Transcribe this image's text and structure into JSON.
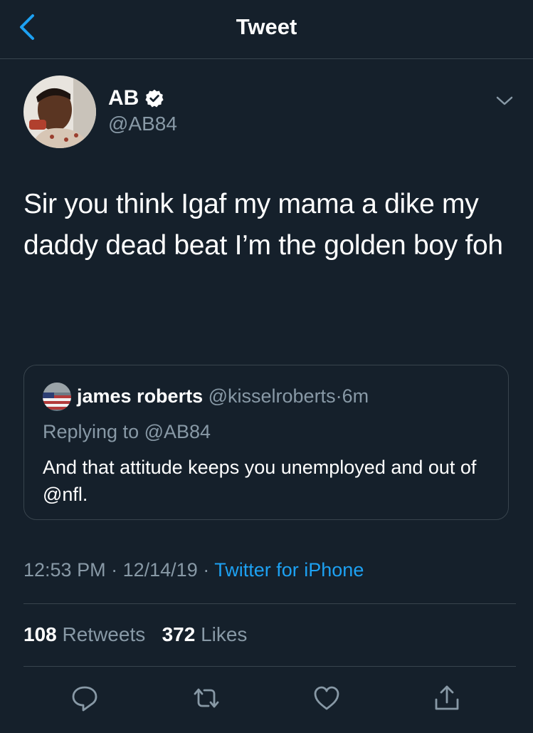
{
  "header": {
    "title": "Tweet",
    "back_icon": "chevron-left-icon"
  },
  "author": {
    "name": "AB",
    "verified": true,
    "handle": "@AB84"
  },
  "tweet": {
    "text": "Sir you think Igaf my mama a dike my daddy dead beat I’m the golden boy foh"
  },
  "quoted": {
    "name": "james roberts",
    "handle": "@kisselroberts",
    "separator": "·",
    "time": "6m",
    "replying_prefix": "Replying to",
    "replying_handle": "@AB84",
    "text": "And that attitude keeps you unemployed and out of @nfl."
  },
  "meta": {
    "time": "12:53 PM",
    "sep1": "·",
    "date": "12/14/19",
    "sep2": "·",
    "source": "Twitter for iPhone"
  },
  "stats": {
    "retweets_count": "108",
    "retweets_label": "Retweets",
    "likes_count": "372",
    "likes_label": "Likes"
  },
  "actions": [
    "reply-icon",
    "retweet-icon",
    "like-icon",
    "share-icon"
  ],
  "colors": {
    "background": "#15202b",
    "accent": "#1da1f2",
    "secondary_text": "#8899a6",
    "border": "#38444d"
  }
}
